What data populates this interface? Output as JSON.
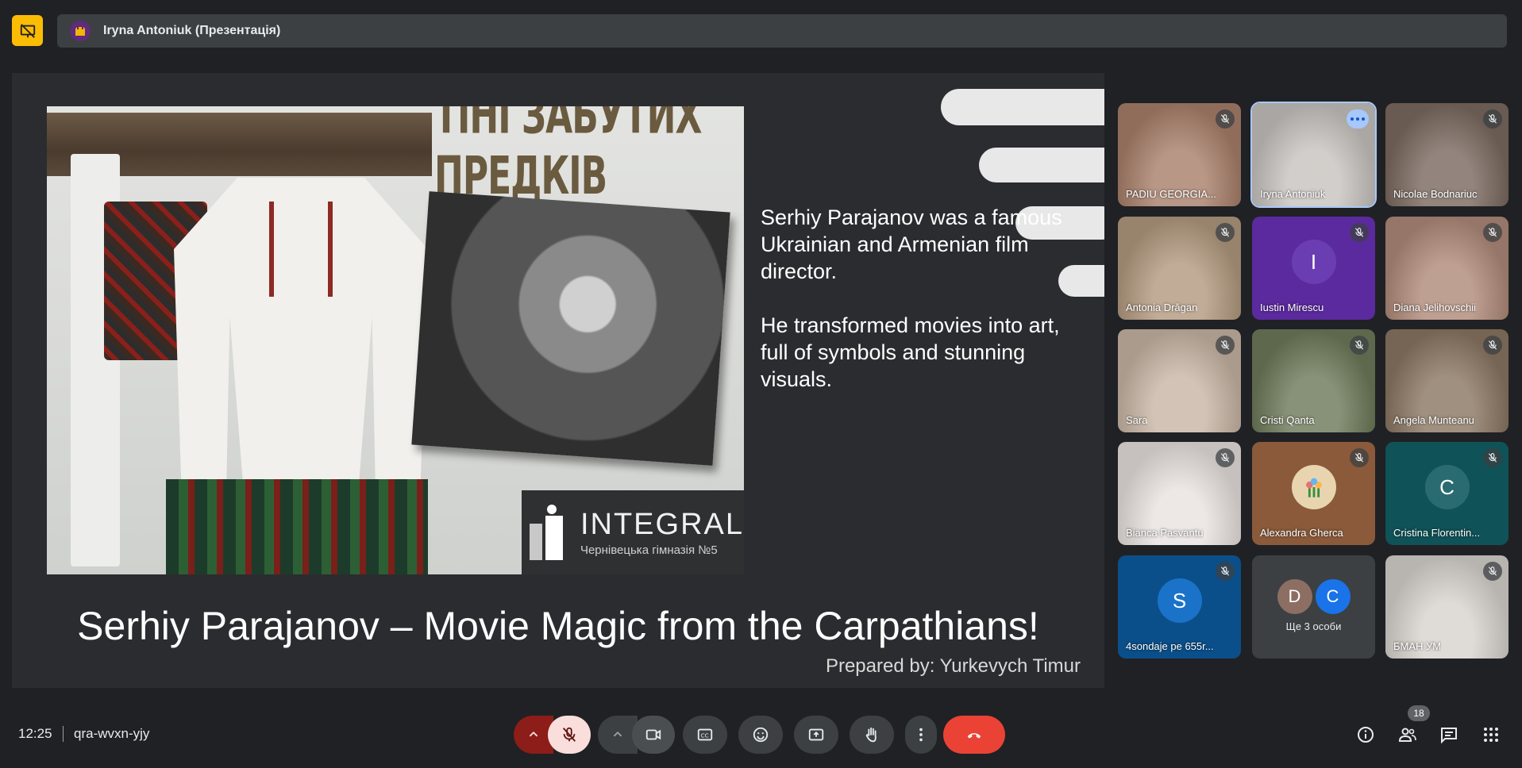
{
  "header": {
    "presenter_label": "Iryna Antoniuk (Презентація)"
  },
  "slide": {
    "image_title": "ТІНІ ЗАБУТИХ ПРЕДКІВ",
    "logo_name": "INTEGRAL",
    "logo_subtitle": "Чернівецька гімназія №5",
    "paragraph_1": "Serhiy Parajanov was a famous Ukrainian and Armenian film director.",
    "paragraph_2": "He transformed movies into art, full of symbols and stunning visuals.",
    "heading": "Serhiy Parajanov – Movie Magic from the Carpathians!",
    "byline": "Prepared by: Yurkevych Timur"
  },
  "participants": [
    {
      "name": "PADIU GEORGIA...",
      "muted": true,
      "bg": "#a9806b"
    },
    {
      "name": "Iryna Antoniuk",
      "muted": false,
      "speaking": true,
      "bg": "#c8c4c0"
    },
    {
      "name": "Nicolae Bodnariuc",
      "muted": true,
      "bg": "#7b6a60"
    },
    {
      "name": "Antonia Drăgan",
      "muted": true,
      "bg": "#b39a80"
    },
    {
      "name": "Iustin Mirescu",
      "muted": true,
      "initial": "I",
      "bg": "#5b2a9e",
      "avatar_bg": "#6b3db3"
    },
    {
      "name": "Diana Jelihovschii",
      "muted": true,
      "bg": "#b08b7a"
    },
    {
      "name": "Sara",
      "muted": true,
      "bg": "#c9b6a6"
    },
    {
      "name": "Cristi Qanta",
      "muted": true,
      "bg": "#6d7a5a"
    },
    {
      "name": "Angela Munteanu",
      "muted": true,
      "bg": "#8b7763"
    },
    {
      "name": "Bianca Pasvantu",
      "muted": true,
      "bg": "#e9e2df"
    },
    {
      "name": "Alexandra Gherca",
      "muted": true,
      "bg": "#8a5a3a",
      "avatar_bg": "#e8d5b0"
    },
    {
      "name": "Cristina Florentin...",
      "muted": true,
      "initial": "C",
      "bg": "#0f5257",
      "avatar_bg": "#2a6b70"
    },
    {
      "name": "4sondaje pe 655r...",
      "muted": true,
      "initial": "S",
      "bg": "#0b4f8a",
      "avatar_bg": "#1a73c9"
    },
    {
      "name": "Ще 3 особи",
      "more": true,
      "initials": [
        "D",
        "C"
      ],
      "bg": "#3c4043"
    },
    {
      "name": "БМАН УМ",
      "muted": true,
      "bg": "#d8d4cf"
    }
  ],
  "footer": {
    "time": "12:25",
    "meeting_code": "qra-wvxn-yjy",
    "participant_count": "18"
  },
  "icons": {
    "present": "presentation-off-icon",
    "mic": "mic-off-icon",
    "camera": "videocam-icon",
    "captions": "closed-caption-icon",
    "emoji": "emoji-icon",
    "share": "present-to-all-icon",
    "hand": "raise-hand-icon",
    "more": "more-vert-icon",
    "end": "call-end-icon",
    "info": "info-icon",
    "people": "people-icon",
    "chat": "chat-icon",
    "apps": "apps-grid-icon"
  },
  "colors": {
    "background": "#202124",
    "accent": "#fbbc04",
    "end_call": "#ea4335"
  }
}
